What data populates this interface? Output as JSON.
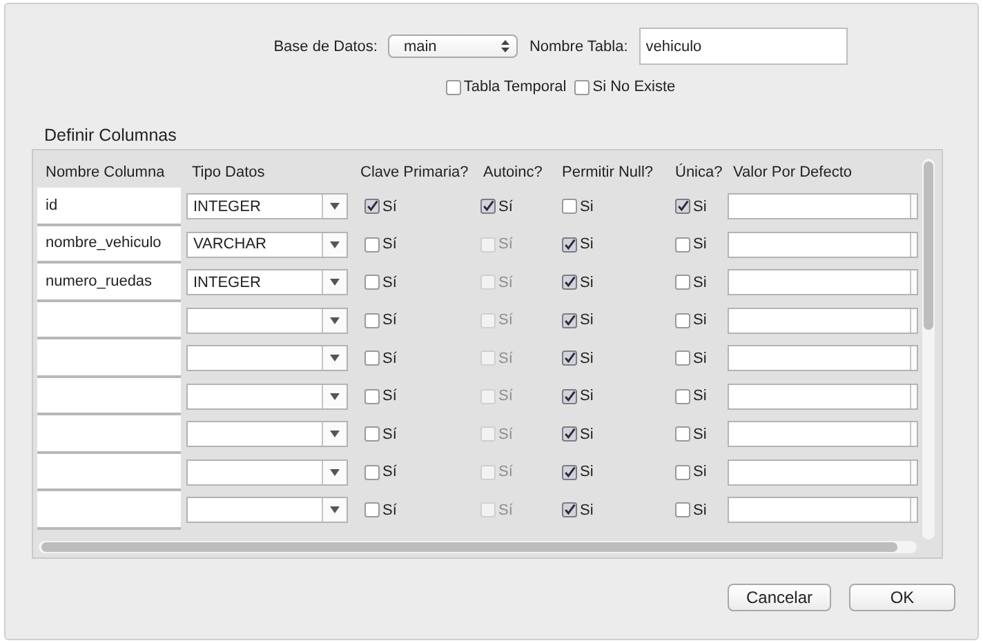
{
  "database": {
    "label": "Base de Datos:",
    "value": "main"
  },
  "table_name": {
    "label": "Nombre Tabla:",
    "value": "vehiculo"
  },
  "options": [
    {
      "label": "Tabla Temporal",
      "checked": false
    },
    {
      "label": "Si No Existe",
      "checked": false
    }
  ],
  "columns_section": {
    "title": "Definir Columnas",
    "headers": [
      "Nombre Columna",
      "Tipo Datos",
      "Clave Primaria?",
      "Autoinc?",
      "Permitir Null?",
      "Única?",
      "Valor Por Defecto"
    ],
    "rows": [
      {
        "name": "id",
        "type": "INTEGER",
        "primary": {
          "label": "Sí",
          "checked": true
        },
        "autoinc": {
          "label": "Sí",
          "checked": true,
          "disabled": false
        },
        "allow_null": {
          "label": "Si",
          "checked": false
        },
        "unique": {
          "label": "Si",
          "checked": true
        }
      },
      {
        "name": "nombre_vehiculo",
        "type": "VARCHAR",
        "primary": {
          "label": "Sí",
          "checked": false
        },
        "autoinc": {
          "label": "Sí",
          "checked": false,
          "disabled": true
        },
        "allow_null": {
          "label": "Si",
          "checked": true
        },
        "unique": {
          "label": "Si",
          "checked": false
        }
      },
      {
        "name": "numero_ruedas",
        "type": "INTEGER",
        "primary": {
          "label": "Sí",
          "checked": false
        },
        "autoinc": {
          "label": "Sí",
          "checked": false,
          "disabled": true
        },
        "allow_null": {
          "label": "Si",
          "checked": true
        },
        "unique": {
          "label": "Si",
          "checked": false
        }
      },
      {
        "name": "",
        "type": "",
        "primary": {
          "label": "Sí",
          "checked": false
        },
        "autoinc": {
          "label": "Sí",
          "checked": false,
          "disabled": true
        },
        "allow_null": {
          "label": "Si",
          "checked": true
        },
        "unique": {
          "label": "Si",
          "checked": false
        }
      },
      {
        "name": "",
        "type": "",
        "primary": {
          "label": "Sí",
          "checked": false
        },
        "autoinc": {
          "label": "Sí",
          "checked": false,
          "disabled": true
        },
        "allow_null": {
          "label": "Si",
          "checked": true
        },
        "unique": {
          "label": "Si",
          "checked": false
        }
      },
      {
        "name": "",
        "type": "",
        "primary": {
          "label": "Sí",
          "checked": false
        },
        "autoinc": {
          "label": "Sí",
          "checked": false,
          "disabled": true
        },
        "allow_null": {
          "label": "Si",
          "checked": true
        },
        "unique": {
          "label": "Si",
          "checked": false
        }
      },
      {
        "name": "",
        "type": "",
        "primary": {
          "label": "Sí",
          "checked": false
        },
        "autoinc": {
          "label": "Sí",
          "checked": false,
          "disabled": true
        },
        "allow_null": {
          "label": "Si",
          "checked": true
        },
        "unique": {
          "label": "Si",
          "checked": false
        }
      },
      {
        "name": "",
        "type": "",
        "primary": {
          "label": "Sí",
          "checked": false
        },
        "autoinc": {
          "label": "Sí",
          "checked": false,
          "disabled": true
        },
        "allow_null": {
          "label": "Si",
          "checked": true
        },
        "unique": {
          "label": "Si",
          "checked": false
        }
      },
      {
        "name": "",
        "type": "",
        "primary": {
          "label": "Sí",
          "checked": false
        },
        "autoinc": {
          "label": "Sí",
          "checked": false,
          "disabled": true
        },
        "allow_null": {
          "label": "Si",
          "checked": true
        },
        "unique": {
          "label": "Si",
          "checked": false
        }
      }
    ]
  },
  "buttons": [
    "Cancelar",
    "OK"
  ]
}
